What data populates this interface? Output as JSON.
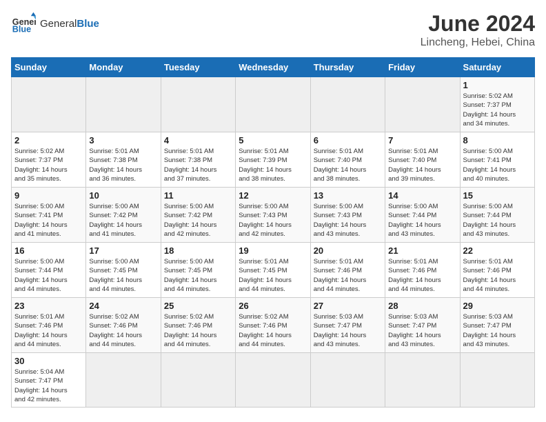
{
  "header": {
    "logo_general": "General",
    "logo_blue": "Blue",
    "title": "June 2024",
    "subtitle": "Lincheng, Hebei, China"
  },
  "weekdays": [
    "Sunday",
    "Monday",
    "Tuesday",
    "Wednesday",
    "Thursday",
    "Friday",
    "Saturday"
  ],
  "weeks": [
    [
      {
        "day": "",
        "info": ""
      },
      {
        "day": "",
        "info": ""
      },
      {
        "day": "",
        "info": ""
      },
      {
        "day": "",
        "info": ""
      },
      {
        "day": "",
        "info": ""
      },
      {
        "day": "",
        "info": ""
      },
      {
        "day": "1",
        "info": "Sunrise: 5:02 AM\nSunset: 7:37 PM\nDaylight: 14 hours\nand 34 minutes."
      }
    ],
    [
      {
        "day": "2",
        "info": "Sunrise: 5:02 AM\nSunset: 7:37 PM\nDaylight: 14 hours\nand 35 minutes."
      },
      {
        "day": "3",
        "info": "Sunrise: 5:01 AM\nSunset: 7:38 PM\nDaylight: 14 hours\nand 36 minutes."
      },
      {
        "day": "4",
        "info": "Sunrise: 5:01 AM\nSunset: 7:38 PM\nDaylight: 14 hours\nand 37 minutes."
      },
      {
        "day": "5",
        "info": "Sunrise: 5:01 AM\nSunset: 7:39 PM\nDaylight: 14 hours\nand 38 minutes."
      },
      {
        "day": "6",
        "info": "Sunrise: 5:01 AM\nSunset: 7:40 PM\nDaylight: 14 hours\nand 38 minutes."
      },
      {
        "day": "7",
        "info": "Sunrise: 5:01 AM\nSunset: 7:40 PM\nDaylight: 14 hours\nand 39 minutes."
      },
      {
        "day": "8",
        "info": "Sunrise: 5:00 AM\nSunset: 7:41 PM\nDaylight: 14 hours\nand 40 minutes."
      }
    ],
    [
      {
        "day": "9",
        "info": "Sunrise: 5:00 AM\nSunset: 7:41 PM\nDaylight: 14 hours\nand 41 minutes."
      },
      {
        "day": "10",
        "info": "Sunrise: 5:00 AM\nSunset: 7:42 PM\nDaylight: 14 hours\nand 41 minutes."
      },
      {
        "day": "11",
        "info": "Sunrise: 5:00 AM\nSunset: 7:42 PM\nDaylight: 14 hours\nand 42 minutes."
      },
      {
        "day": "12",
        "info": "Sunrise: 5:00 AM\nSunset: 7:43 PM\nDaylight: 14 hours\nand 42 minutes."
      },
      {
        "day": "13",
        "info": "Sunrise: 5:00 AM\nSunset: 7:43 PM\nDaylight: 14 hours\nand 43 minutes."
      },
      {
        "day": "14",
        "info": "Sunrise: 5:00 AM\nSunset: 7:44 PM\nDaylight: 14 hours\nand 43 minutes."
      },
      {
        "day": "15",
        "info": "Sunrise: 5:00 AM\nSunset: 7:44 PM\nDaylight: 14 hours\nand 43 minutes."
      }
    ],
    [
      {
        "day": "16",
        "info": "Sunrise: 5:00 AM\nSunset: 7:44 PM\nDaylight: 14 hours\nand 44 minutes."
      },
      {
        "day": "17",
        "info": "Sunrise: 5:00 AM\nSunset: 7:45 PM\nDaylight: 14 hours\nand 44 minutes."
      },
      {
        "day": "18",
        "info": "Sunrise: 5:00 AM\nSunset: 7:45 PM\nDaylight: 14 hours\nand 44 minutes."
      },
      {
        "day": "19",
        "info": "Sunrise: 5:01 AM\nSunset: 7:45 PM\nDaylight: 14 hours\nand 44 minutes."
      },
      {
        "day": "20",
        "info": "Sunrise: 5:01 AM\nSunset: 7:46 PM\nDaylight: 14 hours\nand 44 minutes."
      },
      {
        "day": "21",
        "info": "Sunrise: 5:01 AM\nSunset: 7:46 PM\nDaylight: 14 hours\nand 44 minutes."
      },
      {
        "day": "22",
        "info": "Sunrise: 5:01 AM\nSunset: 7:46 PM\nDaylight: 14 hours\nand 44 minutes."
      }
    ],
    [
      {
        "day": "23",
        "info": "Sunrise: 5:01 AM\nSunset: 7:46 PM\nDaylight: 14 hours\nand 44 minutes."
      },
      {
        "day": "24",
        "info": "Sunrise: 5:02 AM\nSunset: 7:46 PM\nDaylight: 14 hours\nand 44 minutes."
      },
      {
        "day": "25",
        "info": "Sunrise: 5:02 AM\nSunset: 7:46 PM\nDaylight: 14 hours\nand 44 minutes."
      },
      {
        "day": "26",
        "info": "Sunrise: 5:02 AM\nSunset: 7:46 PM\nDaylight: 14 hours\nand 44 minutes."
      },
      {
        "day": "27",
        "info": "Sunrise: 5:03 AM\nSunset: 7:47 PM\nDaylight: 14 hours\nand 43 minutes."
      },
      {
        "day": "28",
        "info": "Sunrise: 5:03 AM\nSunset: 7:47 PM\nDaylight: 14 hours\nand 43 minutes."
      },
      {
        "day": "29",
        "info": "Sunrise: 5:03 AM\nSunset: 7:47 PM\nDaylight: 14 hours\nand 43 minutes."
      }
    ],
    [
      {
        "day": "30",
        "info": "Sunrise: 5:04 AM\nSunset: 7:47 PM\nDaylight: 14 hours\nand 42 minutes."
      },
      {
        "day": "",
        "info": ""
      },
      {
        "day": "",
        "info": ""
      },
      {
        "day": "",
        "info": ""
      },
      {
        "day": "",
        "info": ""
      },
      {
        "day": "",
        "info": ""
      },
      {
        "day": "",
        "info": ""
      }
    ]
  ]
}
